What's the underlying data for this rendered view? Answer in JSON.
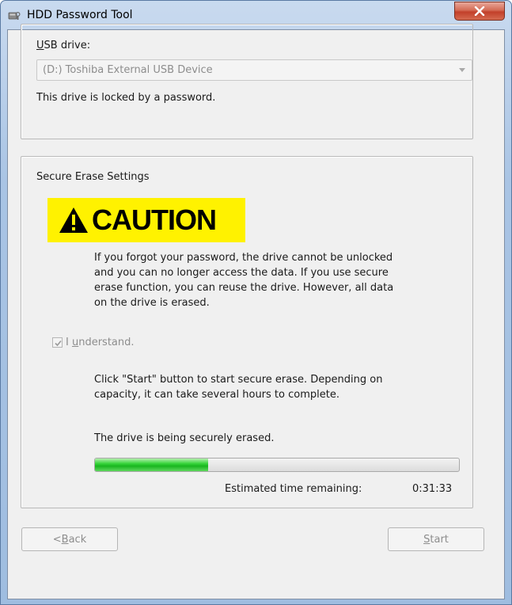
{
  "window": {
    "title": "HDD Password Tool"
  },
  "usb_group": {
    "drive_label_prefix": "",
    "drive_label_accel": "U",
    "drive_label_rest": "SB drive:",
    "selected_drive": "(D:) Toshiba External USB Device",
    "status_text": "This drive is locked by a password."
  },
  "erase_group": {
    "title": "Secure Erase Settings",
    "caution_text": "CAUTION",
    "caution_lines": [
      "If you forgot your password, the drive cannot be unlocked",
      "and you can no longer access the data.  If you use secure",
      "erase function, you can reuse the drive. However, all data",
      "on the drive is erased."
    ],
    "understand_prefix": "I ",
    "understand_accel": "u",
    "understand_rest": "nderstand.",
    "understand_checked": true,
    "instructions_lines": [
      "Click \"Start\" button to start secure erase. Depending on",
      "capacity, it can take several hours to complete."
    ],
    "erase_status": "The drive is being securely erased.",
    "progress_fraction": 0.31,
    "time_remaining_label": "Estimated time remaining:",
    "time_remaining_value": "0:31:33"
  },
  "buttons": {
    "back_prefix": "< ",
    "back_accel": "B",
    "back_rest": "ack",
    "start_accel": "S",
    "start_rest": "tart"
  },
  "colors": {
    "caution_background": "#fff200",
    "progress_fill": "#37d43a"
  }
}
